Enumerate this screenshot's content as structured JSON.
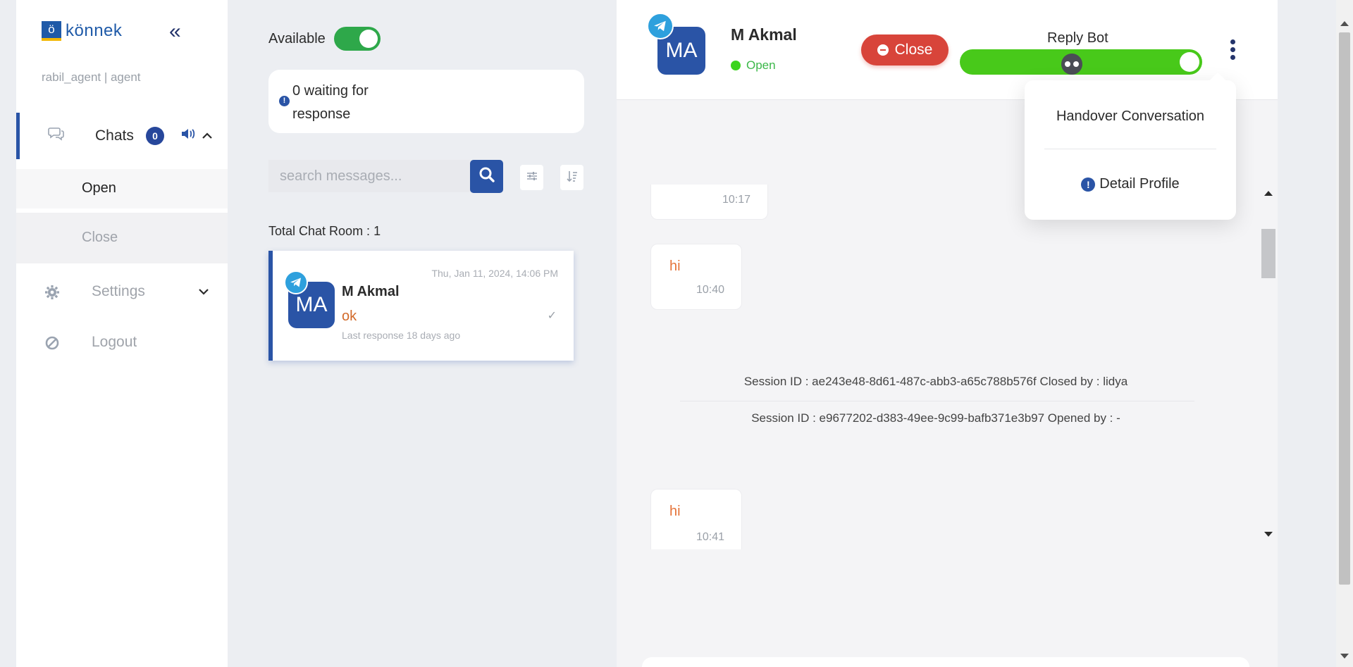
{
  "sidebar": {
    "brand_mark": "ö",
    "brand": "könnek",
    "collapse_icon": "«",
    "user": "rabil_agent | agent",
    "chats": {
      "label": "Chats",
      "badge": "0"
    },
    "chats_submenu": {
      "open": "Open",
      "close": "Close"
    },
    "settings": {
      "label": "Settings"
    },
    "logout": {
      "label": "Logout"
    },
    "icons": [
      "chat-bubbles-icon",
      "speaker-icon",
      "chevron-up-icon",
      "gear-icon",
      "ban-icon",
      "chevron-down-icon"
    ]
  },
  "availability": {
    "label": "Available",
    "on": true
  },
  "waiting": {
    "text": "0 waiting for response"
  },
  "search": {
    "placeholder": "search messages..."
  },
  "chat_list": {
    "total": "Total Chat Room : 1",
    "items": [
      {
        "initials": "MA",
        "name": "M Akmal",
        "date": "Thu, Jan 11, 2024, 14:06 PM",
        "last_message": "ok",
        "last_response": "Last response 18 days ago",
        "check": "✓"
      }
    ]
  },
  "conversation": {
    "initials": "MA",
    "name": "M Akmal",
    "status": "Open",
    "close_label": "Close",
    "reply_bot_label": "Reply Bot",
    "reply_bot_on": true,
    "messages": [
      {
        "text": "",
        "time": "10:17"
      },
      {
        "text": "hi",
        "time": "10:40"
      },
      {
        "text": "hi",
        "time": "10:41"
      }
    ],
    "sessions": [
      "Session ID : ae243e48-8d61-487c-abb3-a65c788b576f Closed by : lidya",
      "Session ID : e9677202-d383-49ee-9c99-bafb371e3b97 Opened by : -"
    ]
  },
  "menu": {
    "handover": "Handover Conversation",
    "detail_profile": "Detail Profile"
  },
  "colors": {
    "primary": "#2a54a6",
    "available_toggle": "#2ea84a",
    "reply_bot": "#48c91a",
    "close_button": "#d8443a",
    "message_text": "#e5743a",
    "telegram": "#2ea0dd"
  }
}
